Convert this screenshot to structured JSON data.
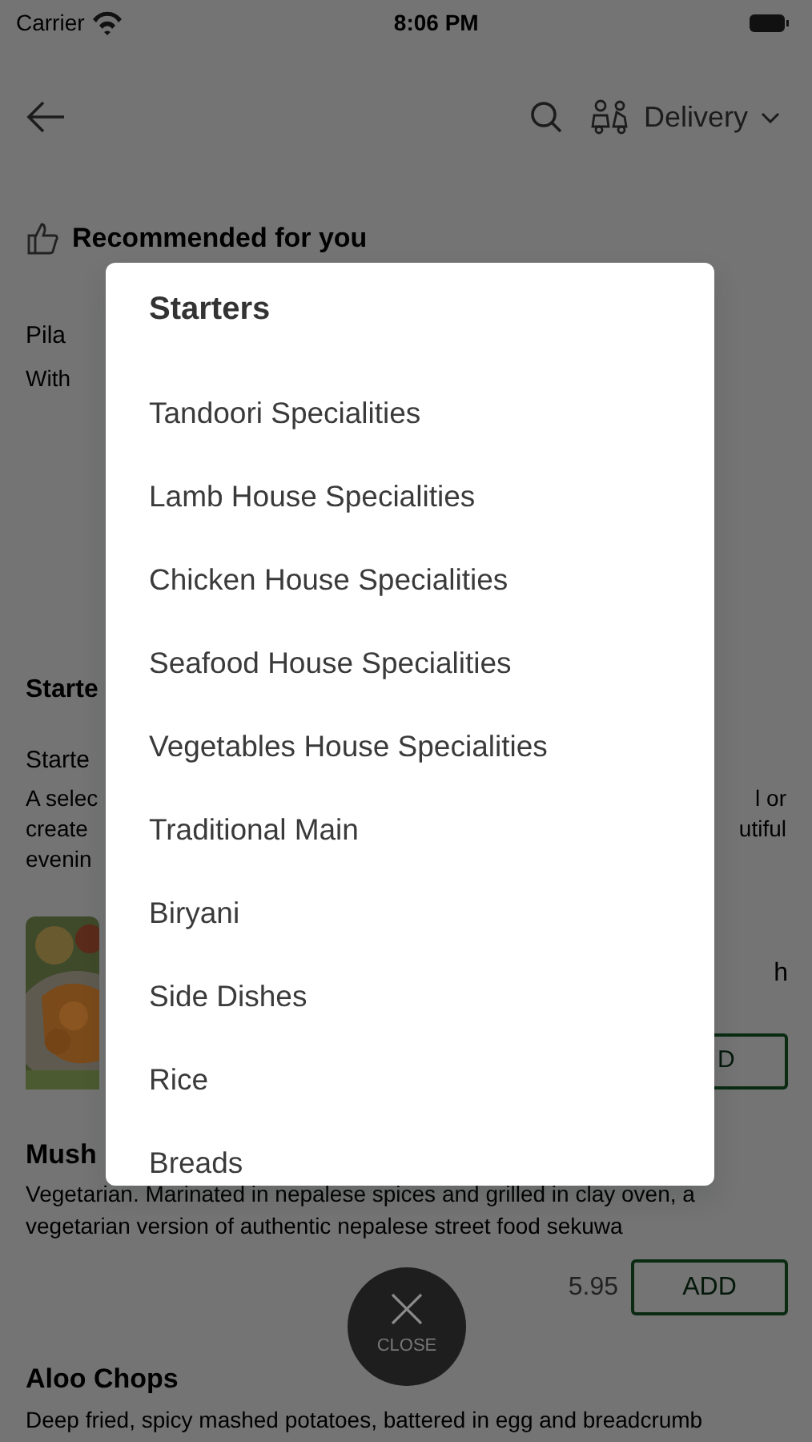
{
  "status_bar": {
    "carrier": "Carrier",
    "time": "8:06 PM"
  },
  "header": {
    "mode": "Delivery"
  },
  "recommended": {
    "title": "Recommended for you",
    "item_name": "Pila",
    "item_description": "With"
  },
  "section": {
    "title": "Starte",
    "subtitle": "Starte",
    "description_lines": [
      {
        "left": "A selec",
        "right": "l or"
      },
      {
        "left": "create",
        "right": "utiful"
      },
      {
        "left": "evenin"
      }
    ]
  },
  "dishes": [
    {
      "kind": "partial",
      "right_text": "h",
      "button": "D"
    },
    {
      "kind": "full",
      "name": "Mush",
      "description": "Vegetarian. Marinated in nepalese spices and grilled in clay oven, a vegetarian version of authentic nepalese street food sekuwa",
      "price": "5.95",
      "button": "ADD"
    },
    {
      "kind": "tail",
      "name": "Aloo Chops",
      "description": "Deep fried, spicy mashed potatoes, battered in egg and breadcrumb"
    }
  ],
  "menu_dialog": {
    "title": "Starters",
    "categories": [
      "Tandoori Specialities",
      "Lamb House Specialities",
      "Chicken House Specialities",
      "Seafood House Specialities",
      "Vegetables House Specialities",
      "Traditional Main",
      "Biryani",
      "Side Dishes",
      "Rice",
      "Breads"
    ]
  },
  "close_button": {
    "label": "CLOSE"
  }
}
